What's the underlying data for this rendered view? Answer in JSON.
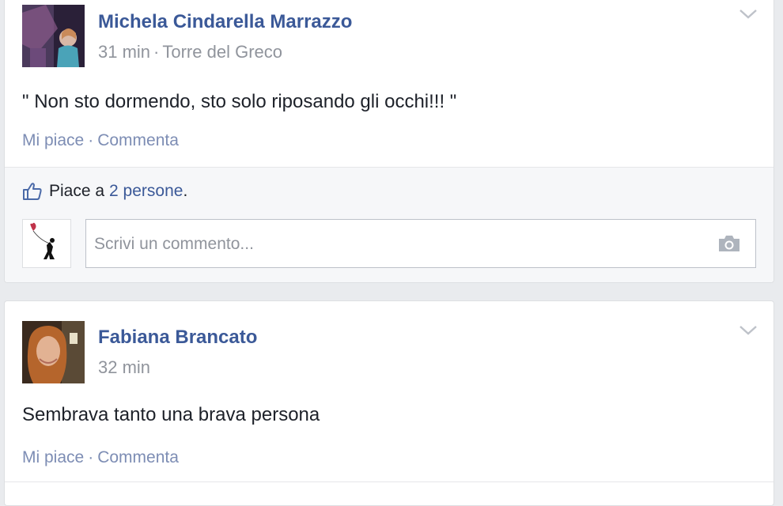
{
  "posts": [
    {
      "author": "Michela Cindarella Marrazzo",
      "time": "31 min",
      "location": "Torre del Greco",
      "text": "\" Non sto dormendo, sto solo riposando gli occhi!!! \"",
      "actions": {
        "like": "Mi piace",
        "comment": "Commenta",
        "separator": "·"
      },
      "likes": {
        "prefix": "Piace a",
        "count": "2 persone",
        "suffix": "."
      },
      "comment_placeholder": "Scrivi un commento..."
    },
    {
      "author": "Fabiana Brancato",
      "time": "32 min",
      "text": "Sembrava tanto una brava persona",
      "actions": {
        "like": "Mi piace",
        "comment": "Commenta",
        "separator": "·"
      }
    }
  ],
  "icons": {
    "menu": "chevron-down-icon",
    "like": "thumbs-up-icon",
    "camera": "camera-icon"
  },
  "colors": {
    "link": "#3b5998",
    "action": "#7d8db4",
    "meta": "#90949c",
    "text": "#1d2129",
    "background": "#e9ebee"
  }
}
